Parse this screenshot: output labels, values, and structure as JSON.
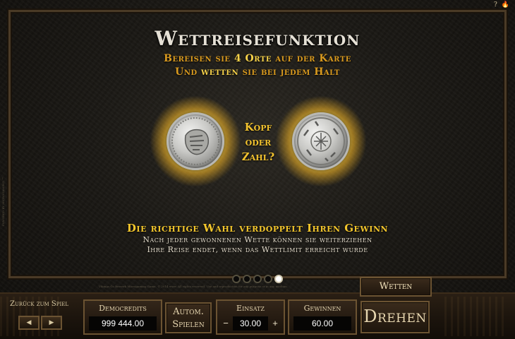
{
  "top_icons": {
    "help": "?",
    "flame": "flame-icon"
  },
  "title": "Wettreisefunktion",
  "subtitle": {
    "line1_pre": "Bereisen sie ",
    "line1_hl": "4 Orte",
    "line1_post": " auf der Karte",
    "line2_pre": "Und ",
    "line2_hl": "wetten",
    "line2_post": " sie bei jedem Halt"
  },
  "question": [
    "Kopf",
    "oder",
    "Zahl?"
  ],
  "result": "Die richtige Wahl verdoppelt Ihren Gewinn",
  "notes": [
    "Nach jeder gewonnenen Wette können sie weiterziehen",
    "Ihre Reise endet, wenn das Wettlimit erreicht wurde"
  ],
  "pagination": {
    "total": 5,
    "active": 5
  },
  "copyright": "Vikings Go Berzerk Microgaming Game. © 2014 www. All rights reserved. Use and reproduction for any purpose or in any medium.",
  "side_text": "POWERED BY MICROGAMING ™",
  "controls": {
    "back_label": "Zurück zum Spiel",
    "prev": "◀",
    "next": "▶",
    "credits_label": "Democredits",
    "credits_value": "999 444.00",
    "auto_line1": "Autom.",
    "auto_line2": "Spielen",
    "bet_label": "Einsatz",
    "bet_value": "30.00",
    "bet_minus": "−",
    "bet_plus": "+",
    "win_label": "Gewinnen",
    "win_value": "60.00",
    "wetten": "Wetten",
    "spin": "Drehen"
  }
}
